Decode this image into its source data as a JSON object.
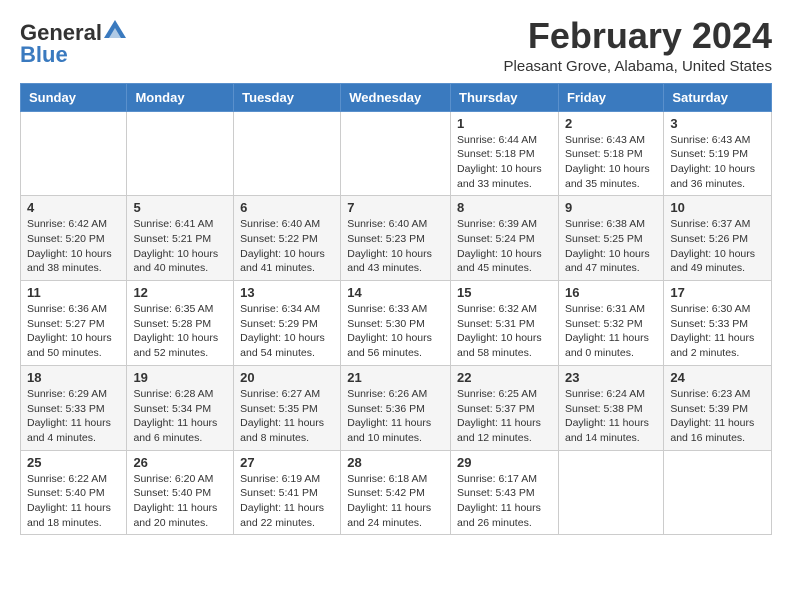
{
  "header": {
    "logo_general": "General",
    "logo_blue": "Blue",
    "month_title": "February 2024",
    "location": "Pleasant Grove, Alabama, United States"
  },
  "days_of_week": [
    "Sunday",
    "Monday",
    "Tuesday",
    "Wednesday",
    "Thursday",
    "Friday",
    "Saturday"
  ],
  "weeks": [
    [
      {
        "day": "",
        "info": ""
      },
      {
        "day": "",
        "info": ""
      },
      {
        "day": "",
        "info": ""
      },
      {
        "day": "",
        "info": ""
      },
      {
        "day": "1",
        "info": "Sunrise: 6:44 AM\nSunset: 5:18 PM\nDaylight: 10 hours and 33 minutes."
      },
      {
        "day": "2",
        "info": "Sunrise: 6:43 AM\nSunset: 5:18 PM\nDaylight: 10 hours and 35 minutes."
      },
      {
        "day": "3",
        "info": "Sunrise: 6:43 AM\nSunset: 5:19 PM\nDaylight: 10 hours and 36 minutes."
      }
    ],
    [
      {
        "day": "4",
        "info": "Sunrise: 6:42 AM\nSunset: 5:20 PM\nDaylight: 10 hours and 38 minutes."
      },
      {
        "day": "5",
        "info": "Sunrise: 6:41 AM\nSunset: 5:21 PM\nDaylight: 10 hours and 40 minutes."
      },
      {
        "day": "6",
        "info": "Sunrise: 6:40 AM\nSunset: 5:22 PM\nDaylight: 10 hours and 41 minutes."
      },
      {
        "day": "7",
        "info": "Sunrise: 6:40 AM\nSunset: 5:23 PM\nDaylight: 10 hours and 43 minutes."
      },
      {
        "day": "8",
        "info": "Sunrise: 6:39 AM\nSunset: 5:24 PM\nDaylight: 10 hours and 45 minutes."
      },
      {
        "day": "9",
        "info": "Sunrise: 6:38 AM\nSunset: 5:25 PM\nDaylight: 10 hours and 47 minutes."
      },
      {
        "day": "10",
        "info": "Sunrise: 6:37 AM\nSunset: 5:26 PM\nDaylight: 10 hours and 49 minutes."
      }
    ],
    [
      {
        "day": "11",
        "info": "Sunrise: 6:36 AM\nSunset: 5:27 PM\nDaylight: 10 hours and 50 minutes."
      },
      {
        "day": "12",
        "info": "Sunrise: 6:35 AM\nSunset: 5:28 PM\nDaylight: 10 hours and 52 minutes."
      },
      {
        "day": "13",
        "info": "Sunrise: 6:34 AM\nSunset: 5:29 PM\nDaylight: 10 hours and 54 minutes."
      },
      {
        "day": "14",
        "info": "Sunrise: 6:33 AM\nSunset: 5:30 PM\nDaylight: 10 hours and 56 minutes."
      },
      {
        "day": "15",
        "info": "Sunrise: 6:32 AM\nSunset: 5:31 PM\nDaylight: 10 hours and 58 minutes."
      },
      {
        "day": "16",
        "info": "Sunrise: 6:31 AM\nSunset: 5:32 PM\nDaylight: 11 hours and 0 minutes."
      },
      {
        "day": "17",
        "info": "Sunrise: 6:30 AM\nSunset: 5:33 PM\nDaylight: 11 hours and 2 minutes."
      }
    ],
    [
      {
        "day": "18",
        "info": "Sunrise: 6:29 AM\nSunset: 5:33 PM\nDaylight: 11 hours and 4 minutes."
      },
      {
        "day": "19",
        "info": "Sunrise: 6:28 AM\nSunset: 5:34 PM\nDaylight: 11 hours and 6 minutes."
      },
      {
        "day": "20",
        "info": "Sunrise: 6:27 AM\nSunset: 5:35 PM\nDaylight: 11 hours and 8 minutes."
      },
      {
        "day": "21",
        "info": "Sunrise: 6:26 AM\nSunset: 5:36 PM\nDaylight: 11 hours and 10 minutes."
      },
      {
        "day": "22",
        "info": "Sunrise: 6:25 AM\nSunset: 5:37 PM\nDaylight: 11 hours and 12 minutes."
      },
      {
        "day": "23",
        "info": "Sunrise: 6:24 AM\nSunset: 5:38 PM\nDaylight: 11 hours and 14 minutes."
      },
      {
        "day": "24",
        "info": "Sunrise: 6:23 AM\nSunset: 5:39 PM\nDaylight: 11 hours and 16 minutes."
      }
    ],
    [
      {
        "day": "25",
        "info": "Sunrise: 6:22 AM\nSunset: 5:40 PM\nDaylight: 11 hours and 18 minutes."
      },
      {
        "day": "26",
        "info": "Sunrise: 6:20 AM\nSunset: 5:40 PM\nDaylight: 11 hours and 20 minutes."
      },
      {
        "day": "27",
        "info": "Sunrise: 6:19 AM\nSunset: 5:41 PM\nDaylight: 11 hours and 22 minutes."
      },
      {
        "day": "28",
        "info": "Sunrise: 6:18 AM\nSunset: 5:42 PM\nDaylight: 11 hours and 24 minutes."
      },
      {
        "day": "29",
        "info": "Sunrise: 6:17 AM\nSunset: 5:43 PM\nDaylight: 11 hours and 26 minutes."
      },
      {
        "day": "",
        "info": ""
      },
      {
        "day": "",
        "info": ""
      }
    ]
  ]
}
